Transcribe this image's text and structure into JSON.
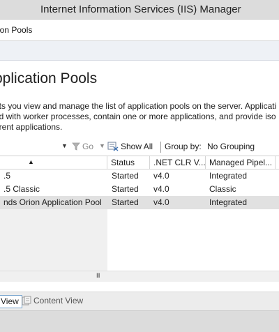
{
  "window": {
    "title": "Internet Information Services (IIS) Manager"
  },
  "address": {
    "crumb": "ion Pools"
  },
  "page": {
    "title": "pplication Pools",
    "description": [
      "ets you view and manage the list of application pools on the server. Applicati",
      "ed with worker processes, contain one or more applications, and provide iso",
      "erent applications."
    ]
  },
  "toolbar": {
    "filter_dropdown_arrow": "▼",
    "go_label": "Go",
    "go_caret": "▼",
    "show_all_label": "Show All",
    "group_by_label": "Group by:",
    "group_by_value": "No Grouping"
  },
  "grid": {
    "sort_indicator": "▲",
    "columns": [
      "",
      "Status",
      ".NET CLR V...",
      "Managed Pipel..."
    ],
    "rows": [
      {
        "name": ".5",
        "status": "Started",
        "clr": "v4.0",
        "pipeline": "Integrated",
        "selected": false
      },
      {
        "name": ".5 Classic",
        "status": "Started",
        "clr": "v4.0",
        "pipeline": "Classic",
        "selected": false
      },
      {
        "name": "nds Orion Application Pool",
        "status": "Started",
        "clr": "v4.0",
        "pipeline": "Integrated",
        "selected": true
      }
    ],
    "scroll_grip": "III"
  },
  "views": {
    "features_tab": "View",
    "content_tab": "Content View"
  },
  "colors": {
    "selected_row": "#e1e1e1",
    "active_tab_border": "#7aa6cf",
    "title_bar": "#dcdcdc"
  }
}
